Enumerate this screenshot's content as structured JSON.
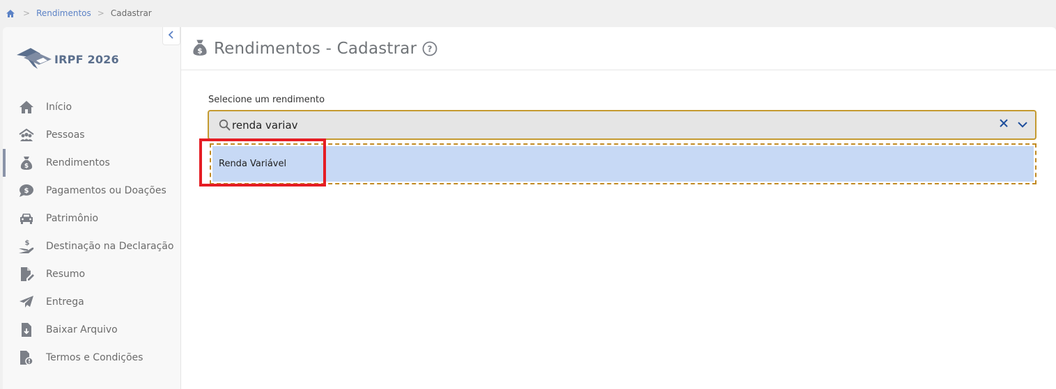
{
  "breadcrumb": {
    "home_icon": "home-icon",
    "items": [
      "Rendimentos",
      "Cadastrar"
    ]
  },
  "app": {
    "title": "IRPF 2026"
  },
  "sidebar": {
    "items": [
      {
        "label": "Início",
        "icon": "home-icon"
      },
      {
        "label": "Pessoas",
        "icon": "people-icon"
      },
      {
        "label": "Rendimentos",
        "icon": "money-bag-icon",
        "active": true
      },
      {
        "label": "Pagamentos ou Doações",
        "icon": "dollar-chat-icon"
      },
      {
        "label": "Patrimônio",
        "icon": "car-icon"
      },
      {
        "label": "Destinação na Declaração",
        "icon": "hand-dollar-icon"
      },
      {
        "label": "Resumo",
        "icon": "document-edit-icon"
      },
      {
        "label": "Entrega",
        "icon": "paper-plane-icon"
      },
      {
        "label": "Baixar Arquivo",
        "icon": "file-download-icon"
      },
      {
        "label": "Termos e Condições",
        "icon": "file-alert-icon"
      }
    ]
  },
  "main": {
    "title": "Rendimentos - Cadastrar",
    "select": {
      "label": "Selecione um rendimento",
      "value": "renda variav"
    },
    "options": [
      "Renda Variável"
    ]
  },
  "colors": {
    "accent_border": "#c49a30",
    "option_bg": "#c7d9f5",
    "highlight": "#e51d24"
  }
}
